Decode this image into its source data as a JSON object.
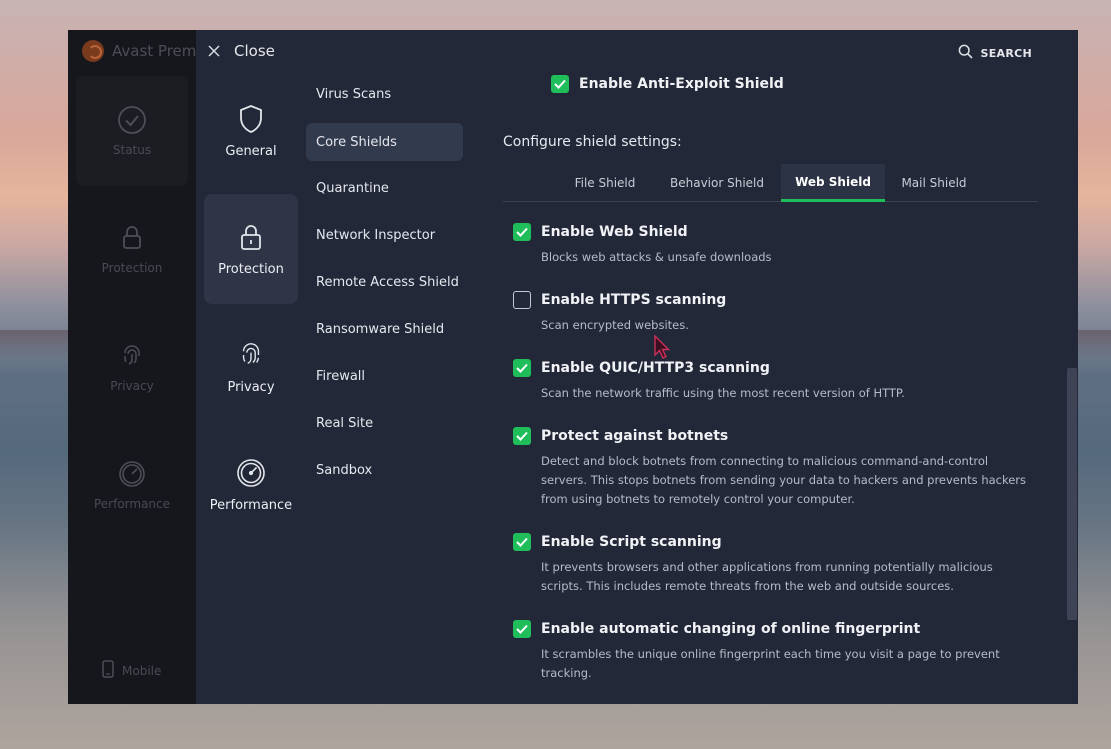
{
  "background_app": {
    "title": "Avast Premi",
    "nav": [
      {
        "label": "Status",
        "icon": "check-circle-icon"
      },
      {
        "label": "Protection",
        "icon": "lock-icon"
      },
      {
        "label": "Privacy",
        "icon": "fingerprint-icon"
      },
      {
        "label": "Performance",
        "icon": "speedometer-icon"
      }
    ],
    "mobile_label": "Mobile"
  },
  "settings": {
    "close_label": "Close",
    "search_label": "SEARCH",
    "categories": [
      {
        "label": "General",
        "icon": "shield-icon"
      },
      {
        "label": "Protection",
        "icon": "lock-icon"
      },
      {
        "label": "Privacy",
        "icon": "fingerprint-icon"
      },
      {
        "label": "Performance",
        "icon": "speedometer-icon"
      }
    ],
    "subnav": [
      "Virus Scans",
      "Core Shields",
      "Quarantine",
      "Network Inspector",
      "Remote Access Shield",
      "Ransomware Shield",
      "Firewall",
      "Real Site",
      "Sandbox"
    ],
    "subnav_active": "Core Shields",
    "top_option": {
      "label": "Enable Anti-Exploit Shield",
      "checked": true
    },
    "config_title": "Configure shield settings:",
    "tabs": [
      "File Shield",
      "Behavior Shield",
      "Web Shield",
      "Mail Shield"
    ],
    "active_tab": "Web Shield",
    "options": [
      {
        "label": "Enable Web Shield",
        "checked": true,
        "desc": "Blocks web attacks & unsafe downloads"
      },
      {
        "label": "Enable HTTPS scanning",
        "checked": false,
        "desc": "Scan encrypted websites."
      },
      {
        "label": "Enable QUIC/HTTP3 scanning",
        "checked": true,
        "desc": "Scan the network traffic using the most recent version of HTTP."
      },
      {
        "label": "Protect against botnets",
        "checked": true,
        "desc": "Detect and block botnets from connecting to malicious command-and-control servers. This stops botnets from sending your data to hackers and prevents hackers from using botnets to remotely control your computer."
      },
      {
        "label": "Enable Script scanning",
        "checked": true,
        "desc": "It prevents browsers and other applications from running potentially malicious scripts. This includes remote threats from the web and outside sources."
      },
      {
        "label": "Enable automatic changing of online fingerprint",
        "checked": true,
        "desc": "It scrambles the unique online fingerprint each time you visit a page to prevent tracking."
      }
    ]
  },
  "colors": {
    "accent_green": "#1fbe5b",
    "panel_bg": "#222838",
    "active_item_bg": "#323a4e"
  }
}
